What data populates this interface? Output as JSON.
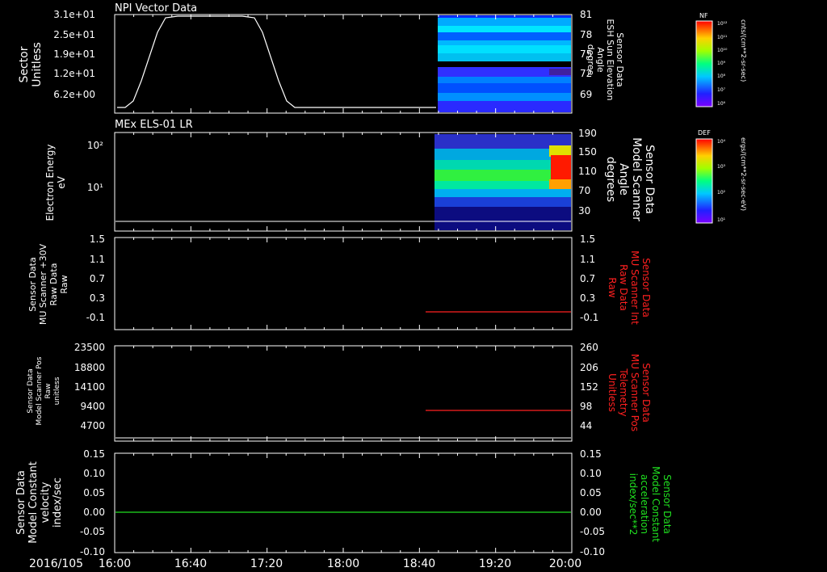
{
  "colors": {
    "axis": "#ffffff",
    "red": "#ff2020",
    "green": "#20e020",
    "background": "#000000"
  },
  "x_axis": {
    "date_label": "2016/105",
    "ticks": [
      "16:00",
      "16:40",
      "17:20",
      "18:00",
      "18:40",
      "19:20",
      "20:00"
    ]
  },
  "panels": [
    {
      "id": "panel1",
      "title": "NPI Vector Data",
      "left_label": [
        "Sector",
        "Unitless"
      ],
      "left_ticks": [
        "3.1e+01",
        "2.5e+01",
        "1.9e+01",
        "1.2e+01",
        "6.2e+00"
      ],
      "right_label": [
        "Sensor Data",
        "ESH Sun Elevation",
        "Angle",
        "degree"
      ],
      "right_ticks": [
        "81",
        "78",
        "75",
        "72",
        "69"
      ],
      "colorbar": {
        "title": "NF",
        "unit": "cnts/(cm**2-sr-sec)",
        "ticks": [
          "10¹²",
          "10¹¹",
          "10¹⁰",
          "10⁹",
          "10⁸",
          "10⁷",
          "10⁶"
        ]
      }
    },
    {
      "id": "panel2",
      "title": "MEx ELS-01 LR",
      "left_label": [
        "Electron Energy",
        "eV"
      ],
      "left_ticks": [
        "10²",
        "10¹"
      ],
      "right_label": [
        "Sensor Data",
        "Model Scanner",
        "Angle",
        "degrees"
      ],
      "right_ticks": [
        "190",
        "150",
        "110",
        "70",
        "30"
      ],
      "colorbar": {
        "title": "DEF",
        "unit": "ergs/(cm**2-sr-sec-eV)",
        "ticks": [
          "10⁴",
          "10³",
          "10²",
          "10¹"
        ]
      }
    },
    {
      "id": "panel3",
      "left_label": [
        "Sensor Data",
        "MU Scanner +30V",
        "Raw Data",
        "Raw"
      ],
      "left_ticks": [
        "1.5",
        "1.1",
        "0.7",
        "0.3",
        "-0.1"
      ],
      "right_label": [
        "Sensor Data",
        "MU Scanner Int",
        "Raw Data",
        "Raw"
      ],
      "right_ticks": [
        "1.5",
        "1.1",
        "0.7",
        "0.3",
        "-0.1"
      ]
    },
    {
      "id": "panel4",
      "left_label": [
        "Sensor Data",
        "Model Scanner Pos",
        "Raw",
        "unitless"
      ],
      "left_ticks": [
        "23500",
        "18800",
        "14100",
        "9400",
        "4700"
      ],
      "right_label": [
        "Sensor Data",
        "MU Scanner Pos",
        "Telemetry",
        "Unitless"
      ],
      "right_ticks": [
        "260",
        "206",
        "152",
        "98",
        "44"
      ]
    },
    {
      "id": "panel5",
      "left_label": [
        "Sensor Data",
        "Model Constant",
        "velocity",
        "index/sec"
      ],
      "left_ticks": [
        "0.15",
        "0.10",
        "0.05",
        "0.00",
        "-0.05",
        "-0.10"
      ],
      "right_label": [
        "Sensor Data",
        "Model Constant",
        "acceleration",
        "index/sec**2"
      ],
      "right_ticks": [
        "0.15",
        "0.10",
        "0.05",
        "0.00",
        "-0.05",
        "-0.10"
      ]
    }
  ],
  "chart_data": [
    {
      "type": "line",
      "title": "NPI Vector Data",
      "ylabel": "Sector Unitless",
      "ylim": [
        0,
        31
      ],
      "x": [
        "16:00",
        "16:10",
        "16:20",
        "16:30",
        "16:40",
        "17:10",
        "17:20",
        "17:30",
        "17:40",
        "18:40"
      ],
      "series": [
        {
          "values": [
            1,
            2,
            12,
            26,
            31,
            31,
            26,
            8,
            1,
            1
          ]
        }
      ]
    },
    {
      "type": "heatmap",
      "title": "MEx ELS-01 LR",
      "ylabel": "Electron Energy eV",
      "x_start": "18:40",
      "x_end": "20:00",
      "peak_region": {
        "x_start": "19:50",
        "x_end": "20:00",
        "level": "10⁴"
      }
    },
    {
      "type": "line",
      "ylabel": "Sensor Data MU Scanner Int Raw Data Raw",
      "ylim": [
        -0.3,
        1.5
      ],
      "x": [
        "18:40",
        "20:00"
      ],
      "series": [
        {
          "name": "Sensor Data MU Scanner Int Raw Data Raw",
          "values": [
            -0.1,
            -0.1
          ]
        }
      ]
    },
    {
      "type": "line",
      "ylabel": "Sensor Data MU Scanner Pos Telemetry Unitless",
      "ylim": [
        17,
        260
      ],
      "x": [
        "18:40",
        "20:00"
      ],
      "series": [
        {
          "name": "Sensor Data MU Scanner Pos Telemetry Unitless",
          "values": [
            85,
            85
          ]
        }
      ]
    },
    {
      "type": "line",
      "ylabel": "Sensor Data Model Constant acceleration index/sec**2",
      "ylim": [
        -0.1,
        0.15
      ],
      "x": [
        "16:00",
        "20:00"
      ],
      "series": [
        {
          "name": "Sensor Data Model Constant acceleration index/sec**2",
          "values": [
            0.0,
            0.0
          ]
        }
      ]
    }
  ]
}
